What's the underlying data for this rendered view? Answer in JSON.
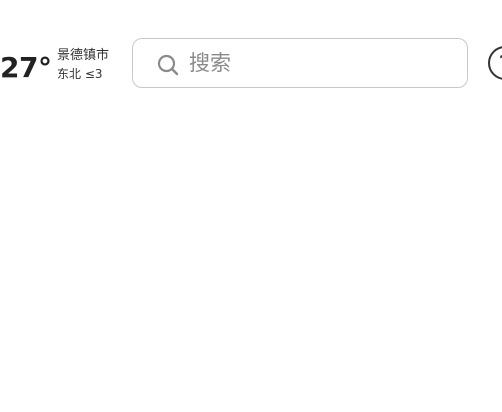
{
  "weather": {
    "temperature": "27°",
    "city": "景德镇市",
    "wind": "东北 ≤3"
  },
  "search": {
    "placeholder": "搜索",
    "value": ""
  },
  "help": {
    "glyph": "?"
  },
  "icons": {
    "search": "search-icon",
    "help": "help-circle-icon"
  },
  "colors": {
    "border": "#c9c9c9",
    "placeholder": "#8a8a8a",
    "text": "#222222"
  }
}
